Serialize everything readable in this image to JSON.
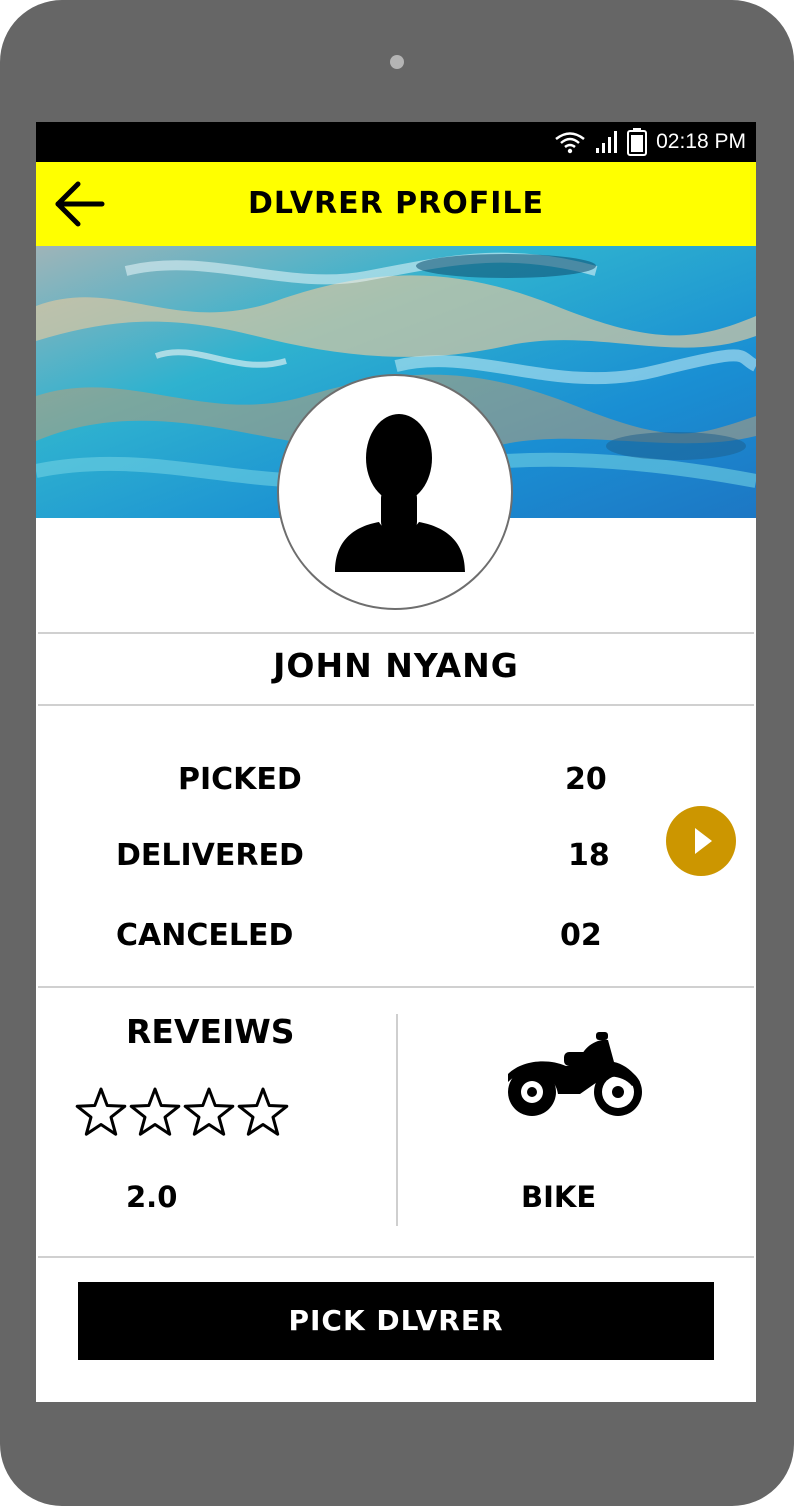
{
  "status_bar": {
    "time": "02:18 PM",
    "icons": [
      "wifi-icon",
      "signal-icon",
      "battery-icon"
    ]
  },
  "app_bar": {
    "title": "DLVRER PROFILE",
    "back_icon": "arrow-left-icon",
    "background_color": "#ffff00"
  },
  "profile": {
    "banner_image": "water-surface",
    "avatar_icon": "person-silhouette-icon",
    "name": "JOHN NYANG"
  },
  "stats": [
    {
      "label": "PICKED",
      "value": "20"
    },
    {
      "label": "DELIVERED",
      "value": "18"
    },
    {
      "label": "CANCELED",
      "value": "02"
    }
  ],
  "next_button_icon": "play-arrow-icon",
  "next_button_color": "#cc9600",
  "reviews": {
    "title": "REVEIWS",
    "rating": "2.0",
    "stars_total": 4,
    "stars_filled": 0
  },
  "vehicle": {
    "icon": "motorcycle-icon",
    "label": "BIKE"
  },
  "action": {
    "pick_label": "PICK DLVRER"
  }
}
